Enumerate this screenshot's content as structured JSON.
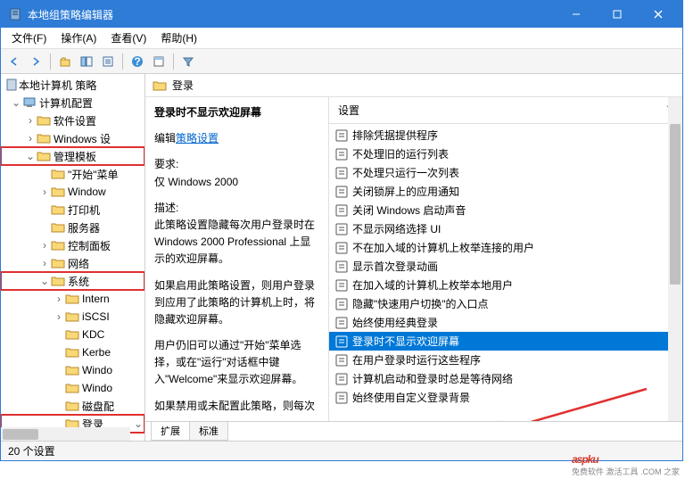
{
  "window": {
    "title": "本地组策略编辑器",
    "buttons": {
      "min": "—",
      "max": "□",
      "close": "✕"
    }
  },
  "menu": {
    "file": "文件(F)",
    "action": "操作(A)",
    "view": "查看(V)",
    "help": "帮助(H)"
  },
  "tree": {
    "root": "本地计算机 策略",
    "computer_cfg": "计算机配置",
    "software": "软件设置",
    "windows_settings": "Windows 设",
    "admin_templates": "管理模板",
    "start_menu": "\"开始\"菜单",
    "windows_sub": "Window",
    "printers": "打印机",
    "server": "服务器",
    "control_panel": "控制面板",
    "network": "网络",
    "system": "系统",
    "intern": "Intern",
    "iscsi": "iSCSI",
    "kdc": "KDC",
    "kerbe": "Kerbe",
    "windo": "Windo",
    "windo2": "Windo",
    "disk_quota": "磁盘配",
    "logon": "登录"
  },
  "right_header": "登录",
  "detail": {
    "title": "登录时不显示欢迎屏幕",
    "edit_label": "编辑",
    "policy_link": "策略设置",
    "req_label": "要求:",
    "req_value": "仅 Windows 2000",
    "desc_label": "描述:",
    "desc1": "此策略设置隐藏每次用户登录时在 Windows 2000 Professional 上显示的欢迎屏幕。",
    "desc2": "如果启用此策略设置，则用户登录到应用了此策略的计算机上时，将隐藏欢迎屏幕。",
    "desc3": "用户仍旧可以通过\"开始\"菜单选择，或在\"运行\"对话框中键入\"Welcome\"来显示欢迎屏幕。",
    "desc4": "如果禁用或未配置此策略，则每次"
  },
  "settings": {
    "header": "设置",
    "items": [
      "排除凭据提供程序",
      "不处理旧的运行列表",
      "不处理只运行一次列表",
      "关闭锁屏上的应用通知",
      "关闭 Windows 启动声音",
      "不显示网络选择 UI",
      "不在加入域的计算机上枚举连接的用户",
      "显示首次登录动画",
      "在加入域的计算机上枚举本地用户",
      "隐藏\"快速用户切换\"的入口点",
      "始终使用经典登录",
      "登录时不显示欢迎屏幕",
      "在用户登录时运行这些程序",
      "计算机启动和登录时总是等待网络",
      "始终使用自定义登录背景"
    ],
    "selected_index": 11
  },
  "tabs": {
    "extended": "扩展",
    "standard": "标准"
  },
  "status": "20 个设置",
  "watermark": {
    "main": "aspku",
    "sub": "免费软件 激活工具 .COM 之家"
  }
}
